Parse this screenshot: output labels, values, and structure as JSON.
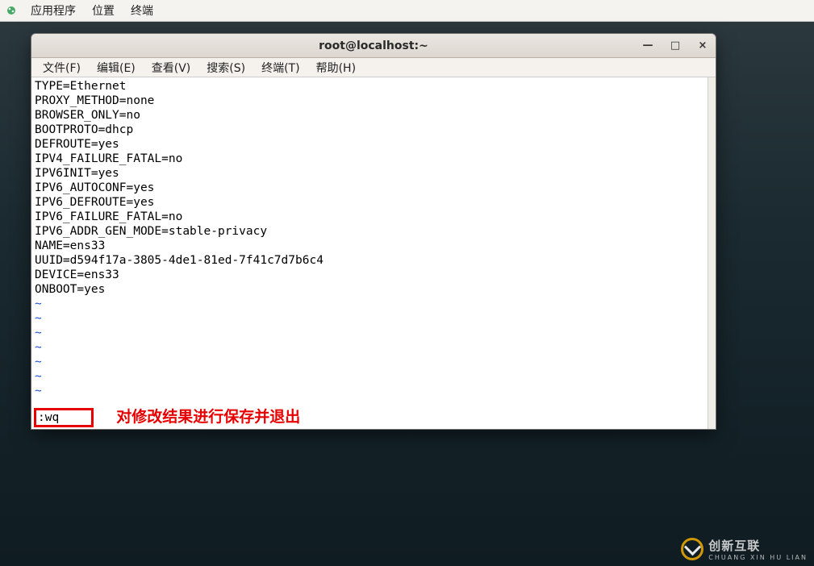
{
  "topbar": {
    "apps": "应用程序",
    "places": "位置",
    "terminal": "终端"
  },
  "window": {
    "title": "root@localhost:~",
    "minimize": "—",
    "maximize": "□",
    "close": "×"
  },
  "menubar": {
    "file": "文件(F)",
    "edit": "编辑(E)",
    "view": "查看(V)",
    "search": "搜索(S)",
    "terminal": "终端(T)",
    "help": "帮助(H)"
  },
  "file_lines": [
    "TYPE=Ethernet",
    "PROXY_METHOD=none",
    "BROWSER_ONLY=no",
    "BOOTPROTO=dhcp",
    "DEFROUTE=yes",
    "IPV4_FAILURE_FATAL=no",
    "IPV6INIT=yes",
    "IPV6_AUTOCONF=yes",
    "IPV6_DEFROUTE=yes",
    "IPV6_FAILURE_FATAL=no",
    "IPV6_ADDR_GEN_MODE=stable-privacy",
    "NAME=ens33",
    "UUID=d594f17a-3805-4de1-81ed-7f41c7d7b6c4",
    "DEVICE=ens33",
    "ONBOOT=yes"
  ],
  "tilde": "~",
  "vi_command": ":wq",
  "annotation_text": "对修改结果进行保存并退出",
  "watermark": {
    "text": "创新互联",
    "sub": "CHUANG XIN HU LIAN"
  }
}
